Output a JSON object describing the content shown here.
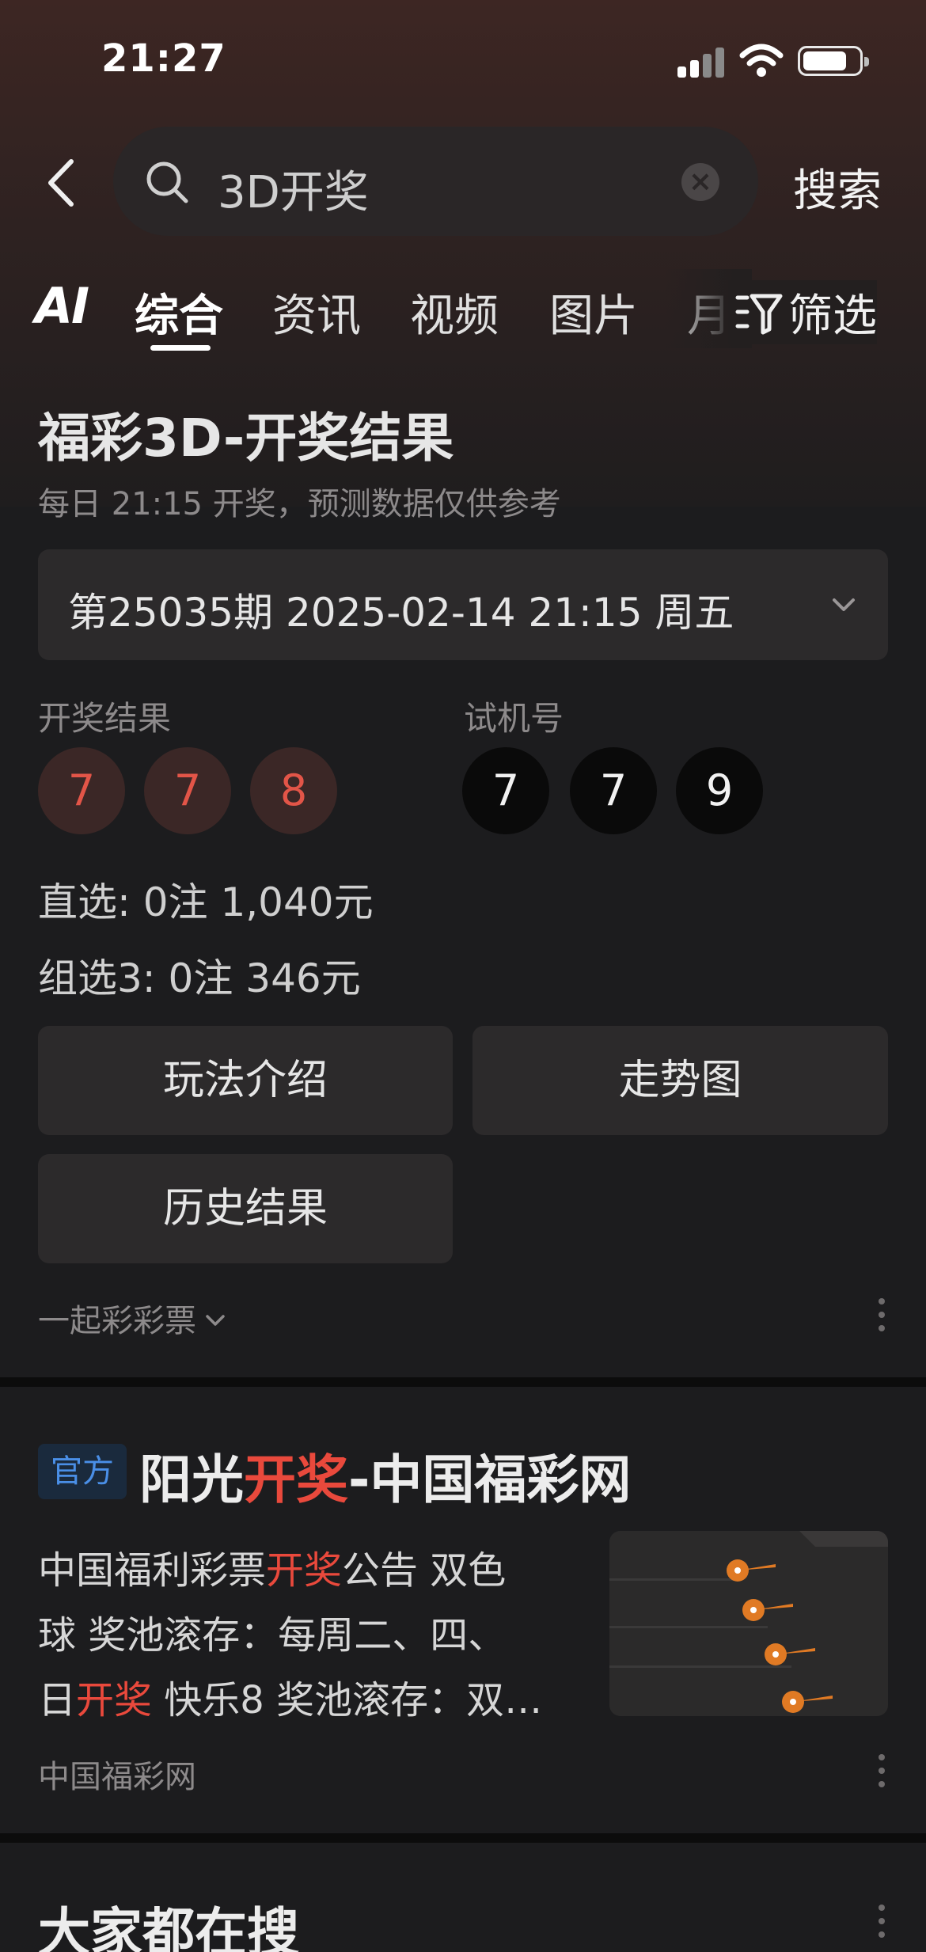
{
  "status_bar": {
    "time": "21:27"
  },
  "search": {
    "query": "3D开奖",
    "button_label": "搜索"
  },
  "tabs": {
    "ai_label": "AI",
    "items": [
      "综合",
      "资讯",
      "视频",
      "图片",
      "月"
    ],
    "active": "综合",
    "filter_label": "筛选"
  },
  "lottery_card": {
    "title": "福彩3D-开奖结果",
    "subtitle": "每日 21:15 开奖，预测数据仅供参考",
    "period": "第25035期 2025-02-14 21:15 周五",
    "result_label": "开奖结果",
    "result_numbers": [
      "7",
      "7",
      "8"
    ],
    "test_label": "试机号",
    "test_numbers": [
      "7",
      "7",
      "9"
    ],
    "prize_direct": "直选: 0注 1,040元",
    "prize_group3": "组选3: 0注 346元",
    "buttons": {
      "intro": "玩法介绍",
      "trend": "走势图",
      "history": "历史结果"
    },
    "source": "一起彩彩票",
    "colors": {
      "result_ball_bg": "#3b2726",
      "result_ball_text": "#e25548",
      "test_ball_bg": "#0a0a0a"
    }
  },
  "result_card": {
    "badge": "官方",
    "title_part1": "阳光",
    "title_highlight": "开奖",
    "title_part2": "-中国福彩网",
    "line1_a": "中国福利彩票",
    "line1_hl": "开奖",
    "line1_b": "公告 双色",
    "line2": "球 奖池滚存：每周二、四、",
    "line3_a": "日",
    "line3_hl": "开奖",
    "line3_b": " 快乐8 奖池滚存：双…",
    "source": "中国福彩网",
    "highlight_color": "#e9493c"
  },
  "hot_search": {
    "title": "大家都在搜"
  }
}
